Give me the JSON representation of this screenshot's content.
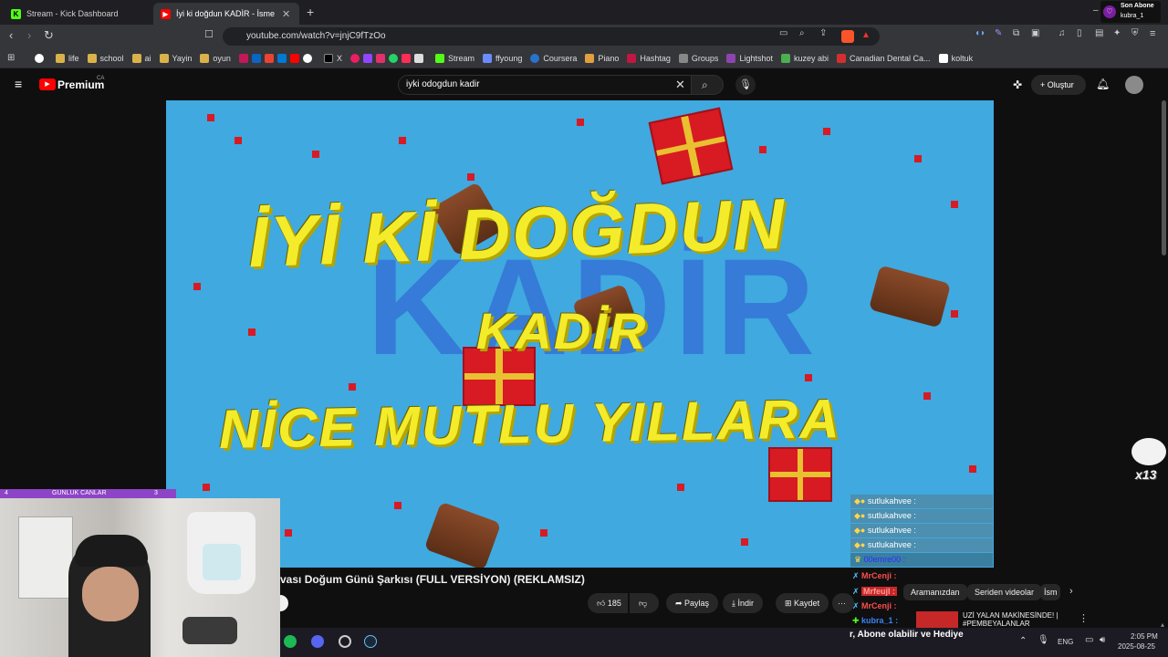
{
  "browser": {
    "tabs": [
      {
        "title": "Stream - Kick Dashboard"
      },
      {
        "title": "İyi ki doğdun KADİR - İsme Ö"
      }
    ],
    "new_tab": "+",
    "url": "youtube.com/watch?v=jnjC9fTzOo",
    "bookmarks": [
      "life",
      "school",
      "ai",
      "Yayin",
      "oyun",
      "X",
      "Stream",
      "ffyoung",
      "Coursera",
      "Piano",
      "Hashtag",
      "Groups",
      "Lightshot",
      "kuzey abi",
      "Canadian Dental Ca...",
      "koltuk"
    ]
  },
  "overlay": {
    "son_abone_label": "Son Abone",
    "son_abone_user": "kubra_1",
    "gunluk": {
      "label": "GUNLUK CANLAR",
      "left": "4",
      "right": "3"
    },
    "mascot_count": "x13"
  },
  "youtube": {
    "logo": "Premium",
    "region": "CA",
    "search_value": "iyki odogdun kadir",
    "create_label": "Oluştur",
    "video_text": {
      "line1": "İYİ Kİ DOĞDUN",
      "line2": "KADİR",
      "line3": "NİCE MUTLU YILLARA",
      "watermark": "KADİR"
    },
    "title": "vası Doğum Günü Şarkısı (FULL VERSİYON) (REKLAMSIZ)",
    "likes": "185",
    "share": "Paylaş",
    "download": "İndir",
    "save": "Kaydet",
    "more": "···",
    "chips": [
      "Aramanızdan",
      "Seriden videolar",
      "İsm"
    ],
    "recommended_title": "UZİ YALAN MAKİNESİNDE! | #PEMBEYALANLAR",
    "recommended_more": "⋮"
  },
  "stream_chat": {
    "donations": [
      {
        "user": "sutlukahvee :"
      },
      {
        "user": "sutlukahvee :"
      },
      {
        "user": "sutlukahvee :"
      },
      {
        "user": "sutlukahvee :"
      },
      {
        "user": "00emre00 :"
      }
    ],
    "messages": [
      {
        "user": "MrCenji :",
        "color": "#ff4d4d"
      },
      {
        "user": "Mrfeujl :",
        "color": "#ff4d4d"
      },
      {
        "user": "MrCenji :",
        "color": "#ff4d4d"
      },
      {
        "user": "kubra_1 :",
        "color": "#3b82f6"
      }
    ],
    "ticker": "r, Abone olabilir ve Hediye"
  },
  "taskbar": {
    "lang": "ENG",
    "time": "2:05 PM",
    "date": "2025-08-25"
  },
  "colors": {
    "kick": "#53fc18",
    "yt_red": "#ff0000",
    "sky": "#3fa9e0",
    "yellow": "#f4ec2a",
    "purple": "#8e44c6"
  }
}
